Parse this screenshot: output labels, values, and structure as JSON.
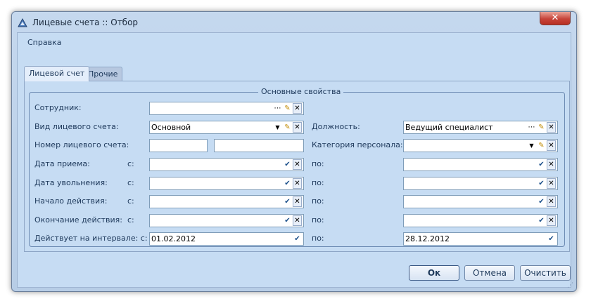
{
  "window": {
    "title": "Лицевые счета :: Отбор",
    "close": "✕"
  },
  "menu": {
    "help": "Справка"
  },
  "tabs": [
    {
      "label": "Лицевой счет"
    },
    {
      "label": "Прочие"
    }
  ],
  "group": {
    "title": "Основные свойства"
  },
  "labels": {
    "employee": "Сотрудник:",
    "account_type": "Вид лицевого счета:",
    "account_number": "Номер лицевого счета:",
    "hire_date": "Дата приема:",
    "dismissal_date": "Дата увольнения:",
    "start_action": "Начало действия:",
    "end_action": "Окончание действия:",
    "active_interval": "Действует на интервале: с:",
    "from": "с:",
    "to": "по:",
    "position": "Должность:",
    "personnel_category": "Категория персонала:"
  },
  "fields": {
    "employee": "",
    "account_type": "Основной",
    "account_number_a": "",
    "account_number_b": "",
    "position": "Ведущий специалист",
    "personnel_category": "",
    "hire_from": "",
    "hire_to": "",
    "dismissal_from": "",
    "dismissal_to": "",
    "start_from": "",
    "start_to": "",
    "end_from": "",
    "end_to": "",
    "interval_from": "01.02.2012",
    "interval_to": "28.12.2012"
  },
  "buttons": {
    "ok": "Ок",
    "cancel": "Отмена",
    "clear": "Очистить"
  },
  "icons": {
    "ellipsis": "⋯",
    "dropdown": "▼",
    "pick": "✎",
    "clear": "✕",
    "check": "✔"
  }
}
